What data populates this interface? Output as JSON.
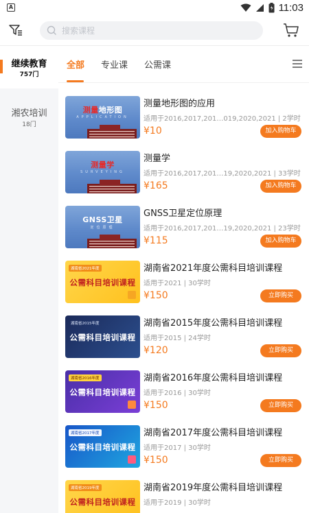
{
  "status_bar": {
    "app_letter": "A",
    "time": "11:03"
  },
  "search": {
    "placeholder": "搜索课程"
  },
  "sidebar": {
    "items": [
      {
        "label": "继续教育",
        "count": "757门",
        "active": true
      },
      {
        "label": "湘农培训",
        "count": "18门",
        "active": false
      }
    ]
  },
  "tabs": [
    {
      "label": "全部",
      "active": true
    },
    {
      "label": "专业课",
      "active": false
    },
    {
      "label": "公需课",
      "active": false
    }
  ],
  "colors": {
    "accent": "#f47a1f",
    "sidebar_bg": "#f5f6f8"
  },
  "courses": [
    {
      "thumb": {
        "style": "blue",
        "title_red": "测量",
        "title_white": "地形图",
        "sub": "APPLICATION"
      },
      "title": "测量地形图的应用",
      "meta": "适用于2016,2017,201…019,2020,2021 | 2学时",
      "price": "¥10",
      "button": "加入购物车"
    },
    {
      "thumb": {
        "style": "blue",
        "title_red": "测量学",
        "title_white": "",
        "sub": "SURVEYING"
      },
      "title": "测量学",
      "meta": "适用于2016,2017,201…19,2020,2021 | 33学时",
      "price": "¥165",
      "button": "加入购物车"
    },
    {
      "thumb": {
        "style": "blue",
        "title_red": "",
        "title_white": "GNSS卫星",
        "sub": "定位原理"
      },
      "title": "GNSS卫星定位原理",
      "meta": "适用于2016,2017,201…19,2020,2021 | 23学时",
      "price": "¥115",
      "button": "加入购物车"
    },
    {
      "thumb": {
        "style": "yellow",
        "tag": "湖南省2021年度",
        "big": "公需科目培训课程"
      },
      "title": "湖南省2021年度公需科目培训课程",
      "meta": "适用于2021 | 30学时",
      "price": "¥150",
      "button": "立即购买"
    },
    {
      "thumb": {
        "style": "navy",
        "tag": "湖南省2015年度",
        "big": "公需科目培训课程"
      },
      "title": "湖南省2015年度公需科目培训课程",
      "meta": "适用于2015 | 24学时",
      "price": "¥120",
      "button": "立即购买"
    },
    {
      "thumb": {
        "style": "purple",
        "tag": "湖南省2016年度",
        "big": "公需科目培训课程"
      },
      "title": "湖南省2016年度公需科目培训课程",
      "meta": "适用于2016 | 30学时",
      "price": "¥150",
      "button": "立即购买"
    },
    {
      "thumb": {
        "style": "cyan",
        "tag": "湖南省2017年度",
        "big": "公需科目培训课程"
      },
      "title": "湖南省2017年度公需科目培训课程",
      "meta": "适用于2017 | 30学时",
      "price": "¥150",
      "button": "立即购买"
    },
    {
      "thumb": {
        "style": "yellow",
        "tag": "湖南省2019年度",
        "big": "公需科目培训课程"
      },
      "title": "湖南省2019年度公需科目培训课程",
      "meta": "适用于2019 | 30学时",
      "price": "",
      "button": ""
    }
  ]
}
